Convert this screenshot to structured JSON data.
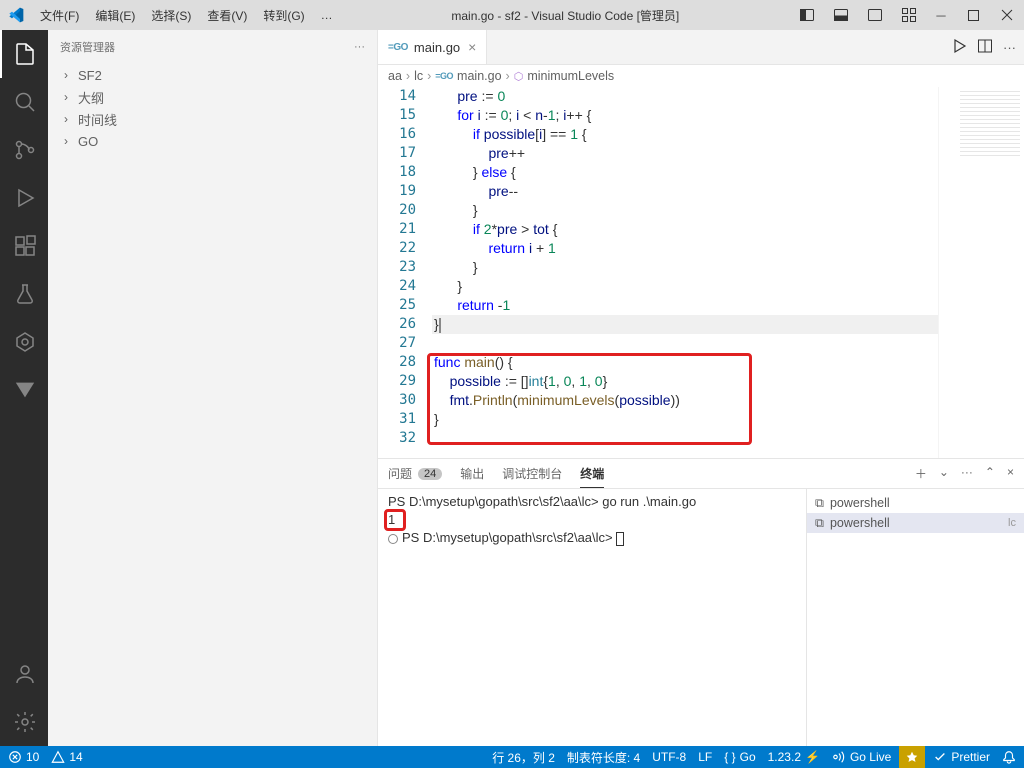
{
  "window_title": "main.go - sf2 - Visual Studio Code [管理员]",
  "menu": {
    "file": "文件(F)",
    "edit": "编辑(E)",
    "select": "选择(S)",
    "view": "查看(V)",
    "goto": "转到(G)",
    "more": "…"
  },
  "sidebar": {
    "title": "资源管理器",
    "items": [
      "SF2",
      "大纲",
      "时间线",
      "GO"
    ]
  },
  "tab": {
    "label": "main.go"
  },
  "breadcrumb": {
    "aa": "aa",
    "lc": "lc",
    "file": "main.go",
    "sym": "minimumLevels"
  },
  "lines": {
    "14": "      pre := 0",
    "15": "      for i := 0; i < n-1; i++ {",
    "16": "          if possible[i] == 1 {",
    "17": "              pre++",
    "18": "          } else {",
    "19": "              pre--",
    "20": "          }",
    "21": "          if 2*pre > tot {",
    "22": "              return i + 1",
    "23": "          }",
    "24": "      }",
    "25": "      return -1",
    "26": "}",
    "27": "",
    "28": "func main() {",
    "29": "    possible := []int{1, 0, 1, 0}",
    "30": "    fmt.Println(minimumLevels(possible))",
    "31": "}",
    "32": ""
  },
  "panel": {
    "problems": "问题",
    "problems_count": "24",
    "output": "输出",
    "debug": "调试控制台",
    "terminal": "终端"
  },
  "term": {
    "line1": "PS D:\\mysetup\\gopath\\src\\sf2\\aa\\lc> go run .\\main.go",
    "line2": "1",
    "line3": "PS D:\\mysetup\\gopath\\src\\sf2\\aa\\lc> "
  },
  "term_list": {
    "a": "powershell",
    "b": "powershell",
    "b_dim": "lc"
  },
  "status": {
    "err": "10",
    "warn": "14",
    "pos": "行 26，列 2",
    "tab": "制表符长度: 4",
    "enc": "UTF-8",
    "eol": "LF",
    "lang": "Go",
    "ver": "1.23.2",
    "golive": "Go Live",
    "prettier": "Prettier"
  }
}
